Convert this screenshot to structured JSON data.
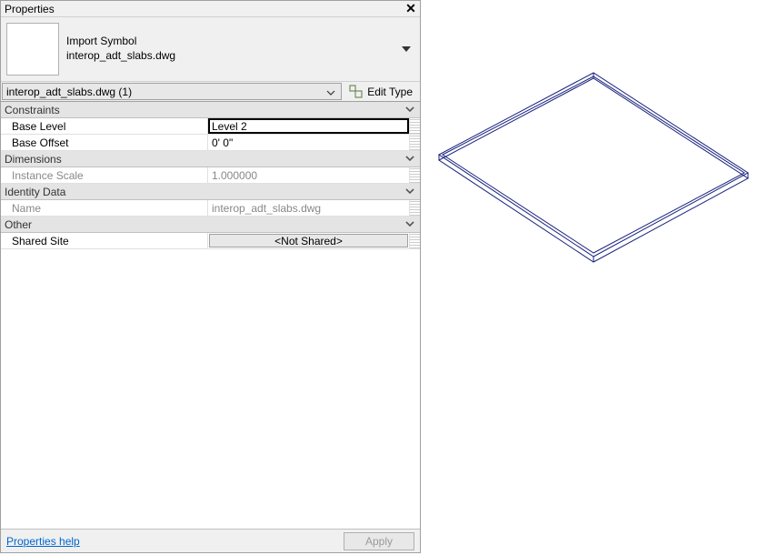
{
  "panel": {
    "title": "Properties",
    "type_family": "Import Symbol",
    "type_name": "interop_adt_slabs.dwg",
    "selector": "interop_adt_slabs.dwg (1)",
    "edit_type_label": "Edit Type"
  },
  "groups": {
    "constraints": {
      "title": "Constraints",
      "base_level": {
        "label": "Base Level",
        "value": "Level 2"
      },
      "base_offset": {
        "label": "Base Offset",
        "value": "0'   0\""
      }
    },
    "dimensions": {
      "title": "Dimensions",
      "instance_scale": {
        "label": "Instance Scale",
        "value": "1.000000"
      }
    },
    "identity": {
      "title": "Identity Data",
      "name": {
        "label": "Name",
        "value": "interop_adt_slabs.dwg"
      }
    },
    "other": {
      "title": "Other",
      "shared_site": {
        "label": "Shared Site",
        "value": "<Not Shared>"
      }
    }
  },
  "footer": {
    "help": "Properties help",
    "apply": "Apply"
  }
}
